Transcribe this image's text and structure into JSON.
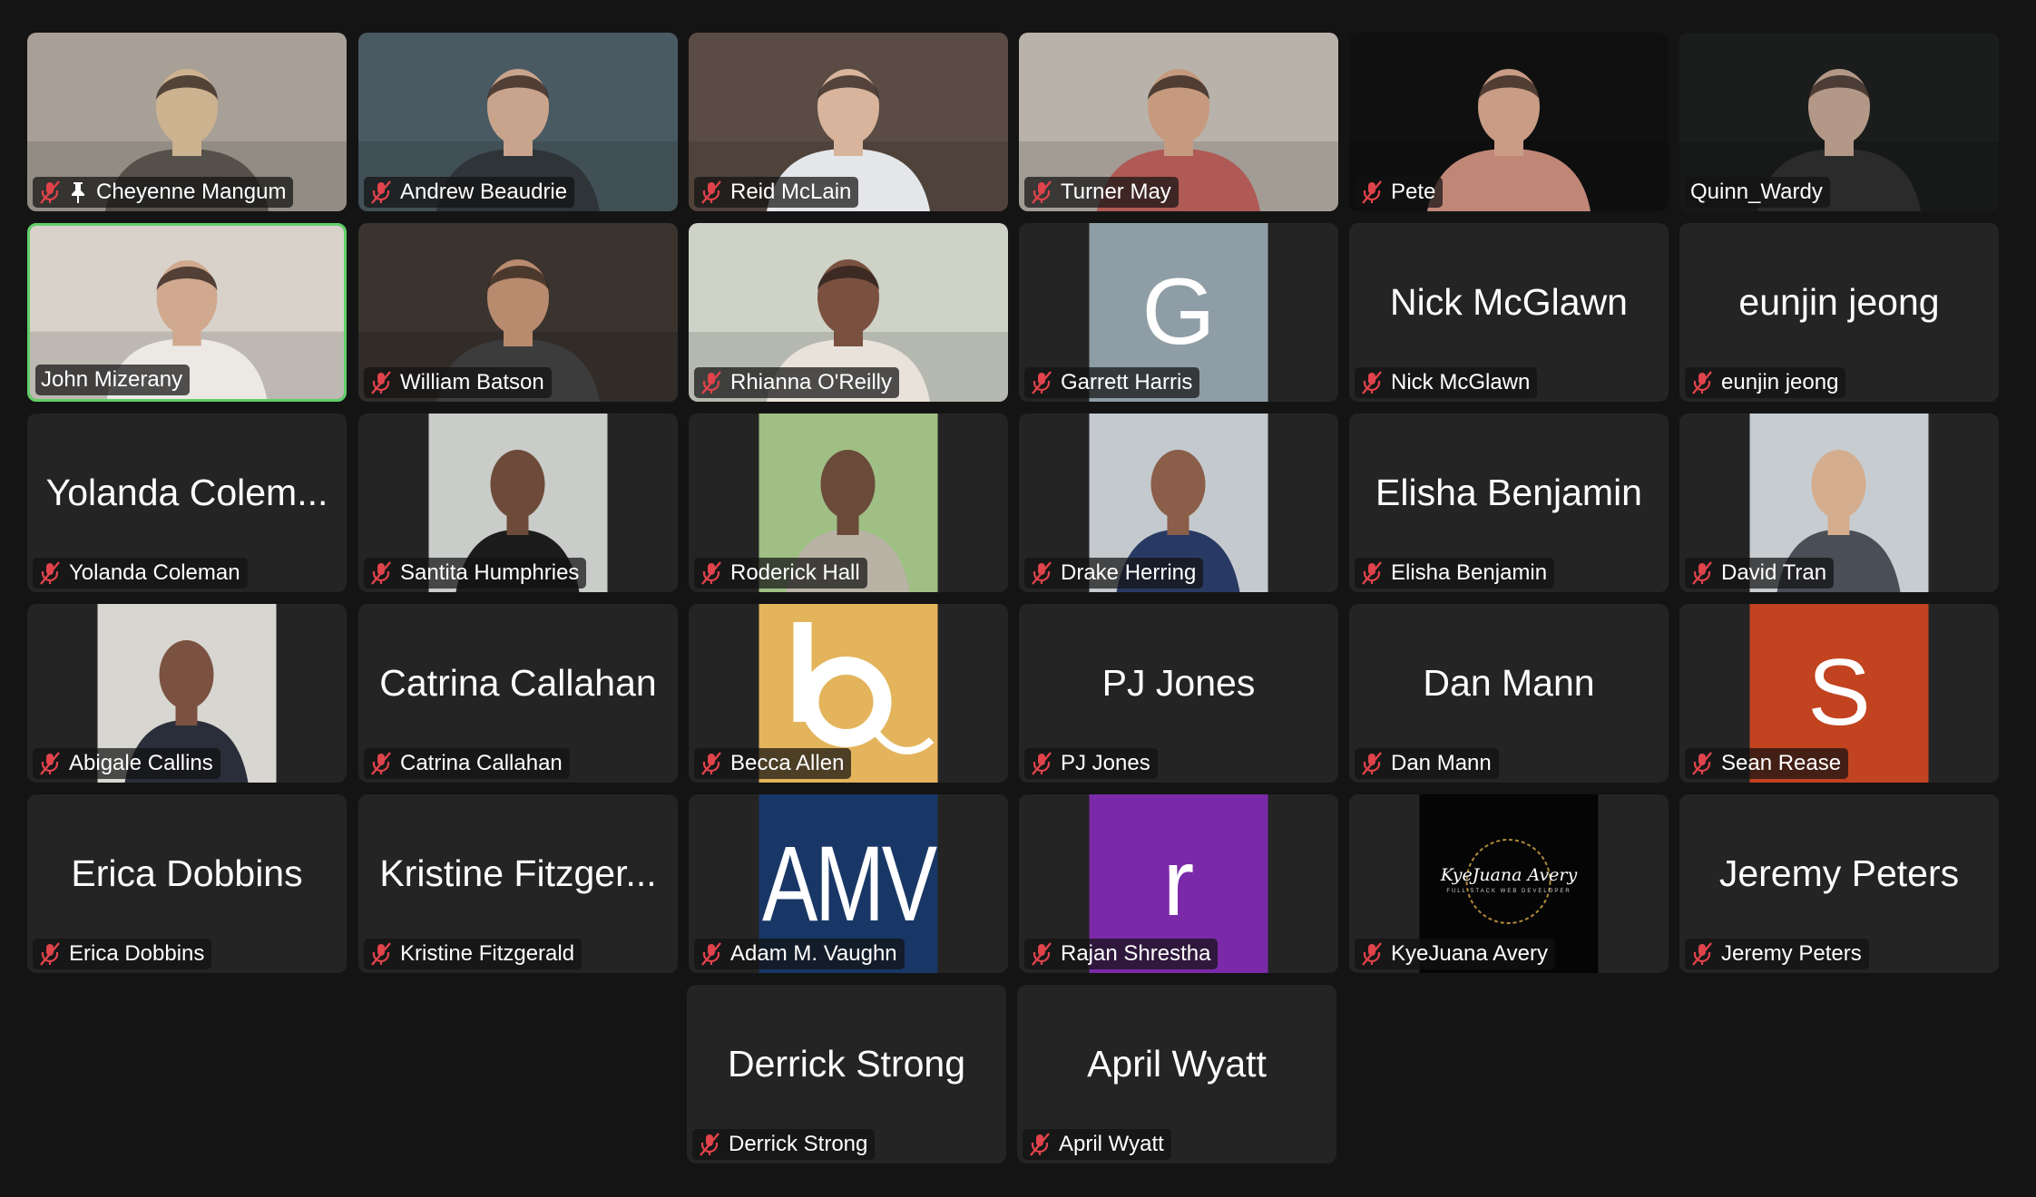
{
  "participants": [
    {
      "name": "Cheyenne Mangum",
      "muted": true,
      "pinned": true,
      "kind": "video",
      "bg": "#a8a096",
      "person": "#ccb28f",
      "shirt": "#55504a"
    },
    {
      "name": "Andrew Beaudrie",
      "muted": true,
      "kind": "video",
      "bg": "#4a5a62",
      "person": "#c9a48d",
      "shirt": "#2f3438"
    },
    {
      "name": "Reid McLain",
      "muted": true,
      "kind": "video",
      "bg": "#5a4c44",
      "person": "#d7b49b",
      "shirt": "#e4e6ea"
    },
    {
      "name": "Turner May",
      "muted": true,
      "kind": "video",
      "bg": "#b9b2aa",
      "person": "#c69a7f",
      "shirt": "#b05a55"
    },
    {
      "name": "Pete",
      "muted": true,
      "kind": "video",
      "bg": "#101010",
      "person": "#c99c85",
      "shirt": "#c08777"
    },
    {
      "name": "Quinn_Wardy",
      "muted": false,
      "kind": "video",
      "bg": "#1a1d1c",
      "person": "#b39888",
      "shirt": "#2b2b2b"
    },
    {
      "name": "John Mizerany",
      "muted": false,
      "active": true,
      "kind": "video",
      "bg": "#d8d2cb",
      "person": "#d0a98e",
      "shirt": "#ece8e4"
    },
    {
      "name": "William Batson",
      "muted": true,
      "kind": "video",
      "bg": "#3a332e",
      "person": "#b88a6e",
      "shirt": "#3c3c3c"
    },
    {
      "name": "Rhianna O'Reilly",
      "muted": true,
      "kind": "video",
      "bg": "#cfd2c6",
      "person": "#7a5140",
      "shirt": "#e8e2da"
    },
    {
      "name": "Garrett Harris",
      "muted": true,
      "kind": "letter",
      "letter": "G",
      "color": "#8f9ea6"
    },
    {
      "name": "Nick McGlawn",
      "muted": true,
      "kind": "text"
    },
    {
      "name": "eunjin jeong",
      "muted": true,
      "kind": "text"
    },
    {
      "name": "Yolanda Coleman",
      "display": "Yolanda Colem...",
      "muted": true,
      "kind": "text"
    },
    {
      "name": "Santita Humphries",
      "muted": true,
      "kind": "photo",
      "bg": "#c9ccc8",
      "person": "#6d4a39",
      "shirt": "#1c1c1c"
    },
    {
      "name": "Roderick Hall",
      "muted": true,
      "kind": "photo",
      "bg": "#9fbf85",
      "person": "#6b4a3a",
      "shirt": "#b9b3a6"
    },
    {
      "name": "Drake Herring",
      "muted": true,
      "kind": "photo",
      "bg": "#c4c9ce",
      "person": "#8a5e48",
      "shirt": "#283a64"
    },
    {
      "name": "Elisha Benjamin",
      "muted": true,
      "kind": "text"
    },
    {
      "name": "David Tran",
      "muted": true,
      "kind": "photo",
      "bg": "#c7ccd0",
      "person": "#d4ad8e",
      "shirt": "#4a4e56"
    },
    {
      "name": "Abigale Callins",
      "muted": true,
      "kind": "photo",
      "bg": "#d8d6d0",
      "person": "#7b5141",
      "shirt": "#2a2e3a"
    },
    {
      "name": "Catrina Callahan",
      "muted": true,
      "kind": "text"
    },
    {
      "name": "Becca Allen",
      "muted": true,
      "kind": "logo-b",
      "color": "#e3b45b"
    },
    {
      "name": "PJ Jones",
      "muted": true,
      "kind": "text"
    },
    {
      "name": "Dan Mann",
      "muted": true,
      "kind": "text"
    },
    {
      "name": "Sean Rease",
      "muted": true,
      "kind": "letter",
      "letter": "S",
      "color": "#c2431f"
    },
    {
      "name": "Erica Dobbins",
      "muted": true,
      "kind": "text"
    },
    {
      "name": "Kristine Fitzgerald",
      "display": "Kristine Fitzger...",
      "muted": true,
      "kind": "text"
    },
    {
      "name": "Adam M. Vaughn",
      "muted": true,
      "kind": "amv",
      "color": "#183766",
      "logo": "AMV"
    },
    {
      "name": "Rajan Shrestha",
      "muted": true,
      "kind": "letter",
      "letter": "r",
      "color": "#7a2aa8"
    },
    {
      "name": "KyeJuana Avery",
      "muted": true,
      "kind": "kya",
      "logo": "KyeJuana Avery",
      "sub": "FULL STACK WEB DEVELOPER"
    },
    {
      "name": "Jeremy Peters",
      "muted": true,
      "kind": "text"
    },
    {
      "name": "Derrick Strong",
      "muted": true,
      "kind": "text"
    },
    {
      "name": "April Wyatt",
      "muted": true,
      "kind": "text"
    }
  ],
  "colors": {
    "muted_icon": "#e0434b",
    "active_border": "#5fd068",
    "tile_bg": "#242424",
    "page_bg": "#141414"
  }
}
